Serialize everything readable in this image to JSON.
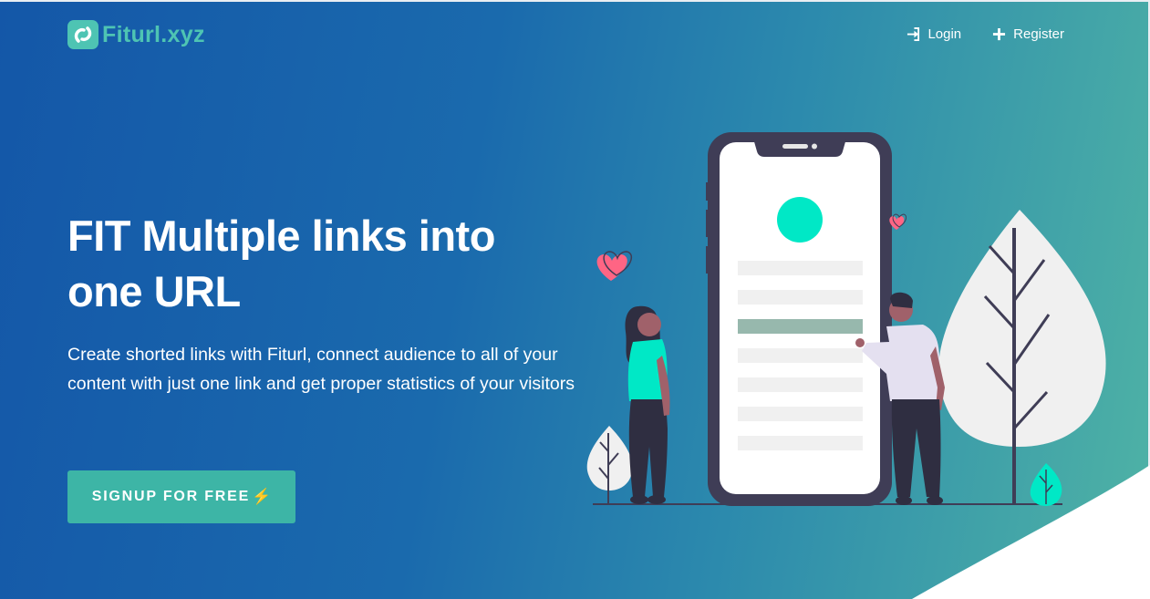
{
  "brand": {
    "name": "Fiturl.xyz",
    "logo_icon": "link-chain-icon",
    "accent": "#4ec4b3"
  },
  "nav": {
    "login": {
      "label": "Login",
      "icon": "sign-in-icon"
    },
    "register": {
      "label": "Register",
      "icon": "plus-icon"
    }
  },
  "hero": {
    "title": "FIT Multiple links into one URL",
    "subtitle": "Create shorted links with Fiturl, connect audience to all of your content with just one link and get proper statistics of your visitors",
    "cta": {
      "label": "SIGNUP FOR FREE",
      "icon": "lightning-icon",
      "glyph": "⚡",
      "color": "#3db5a6"
    }
  },
  "colors": {
    "gradient_start": "#1457a8",
    "gradient_end": "#4fb3a5",
    "phone_frame": "#3f3d56",
    "highlight": "#00e8c6",
    "heart": "#ff6584"
  }
}
